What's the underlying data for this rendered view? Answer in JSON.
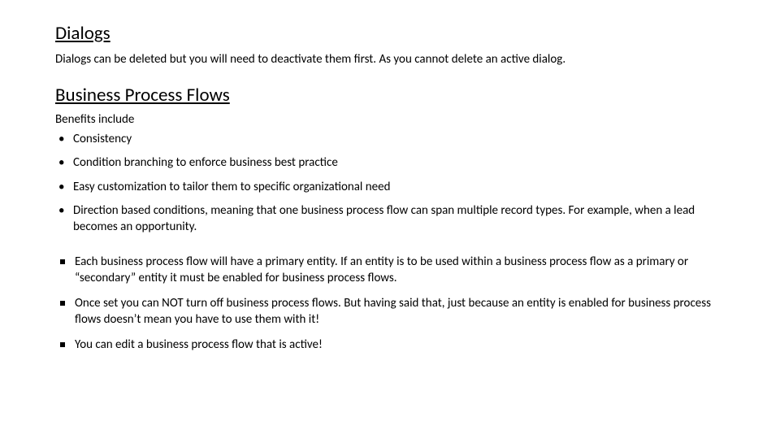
{
  "sections": {
    "dialogs": {
      "heading": "Dialogs",
      "body": "Dialogs can be deleted but you will need to deactivate them first. As you cannot delete an active dialog."
    },
    "bpf": {
      "heading": "Business Process Flows",
      "sub_label": "Benefits include",
      "benefits": [
        "Consistency",
        "Condition branching to enforce business best practice",
        "Easy customization to tailor them to specific organizational need",
        "Direction based conditions, meaning that one business process flow can span multiple record types. For example, when a lead becomes an opportunity."
      ],
      "notes": [
        "Each business process flow will have a primary entity. If an entity is to be used within a business process flow as a primary or “secondary” entity it must be enabled for business process flows.",
        "Once set you can NOT turn off business process flows. But having said that, just because an entity is enabled for business process flows doesn’t mean you have to use them with it!",
        "You can edit a business process flow that is active!"
      ]
    }
  }
}
